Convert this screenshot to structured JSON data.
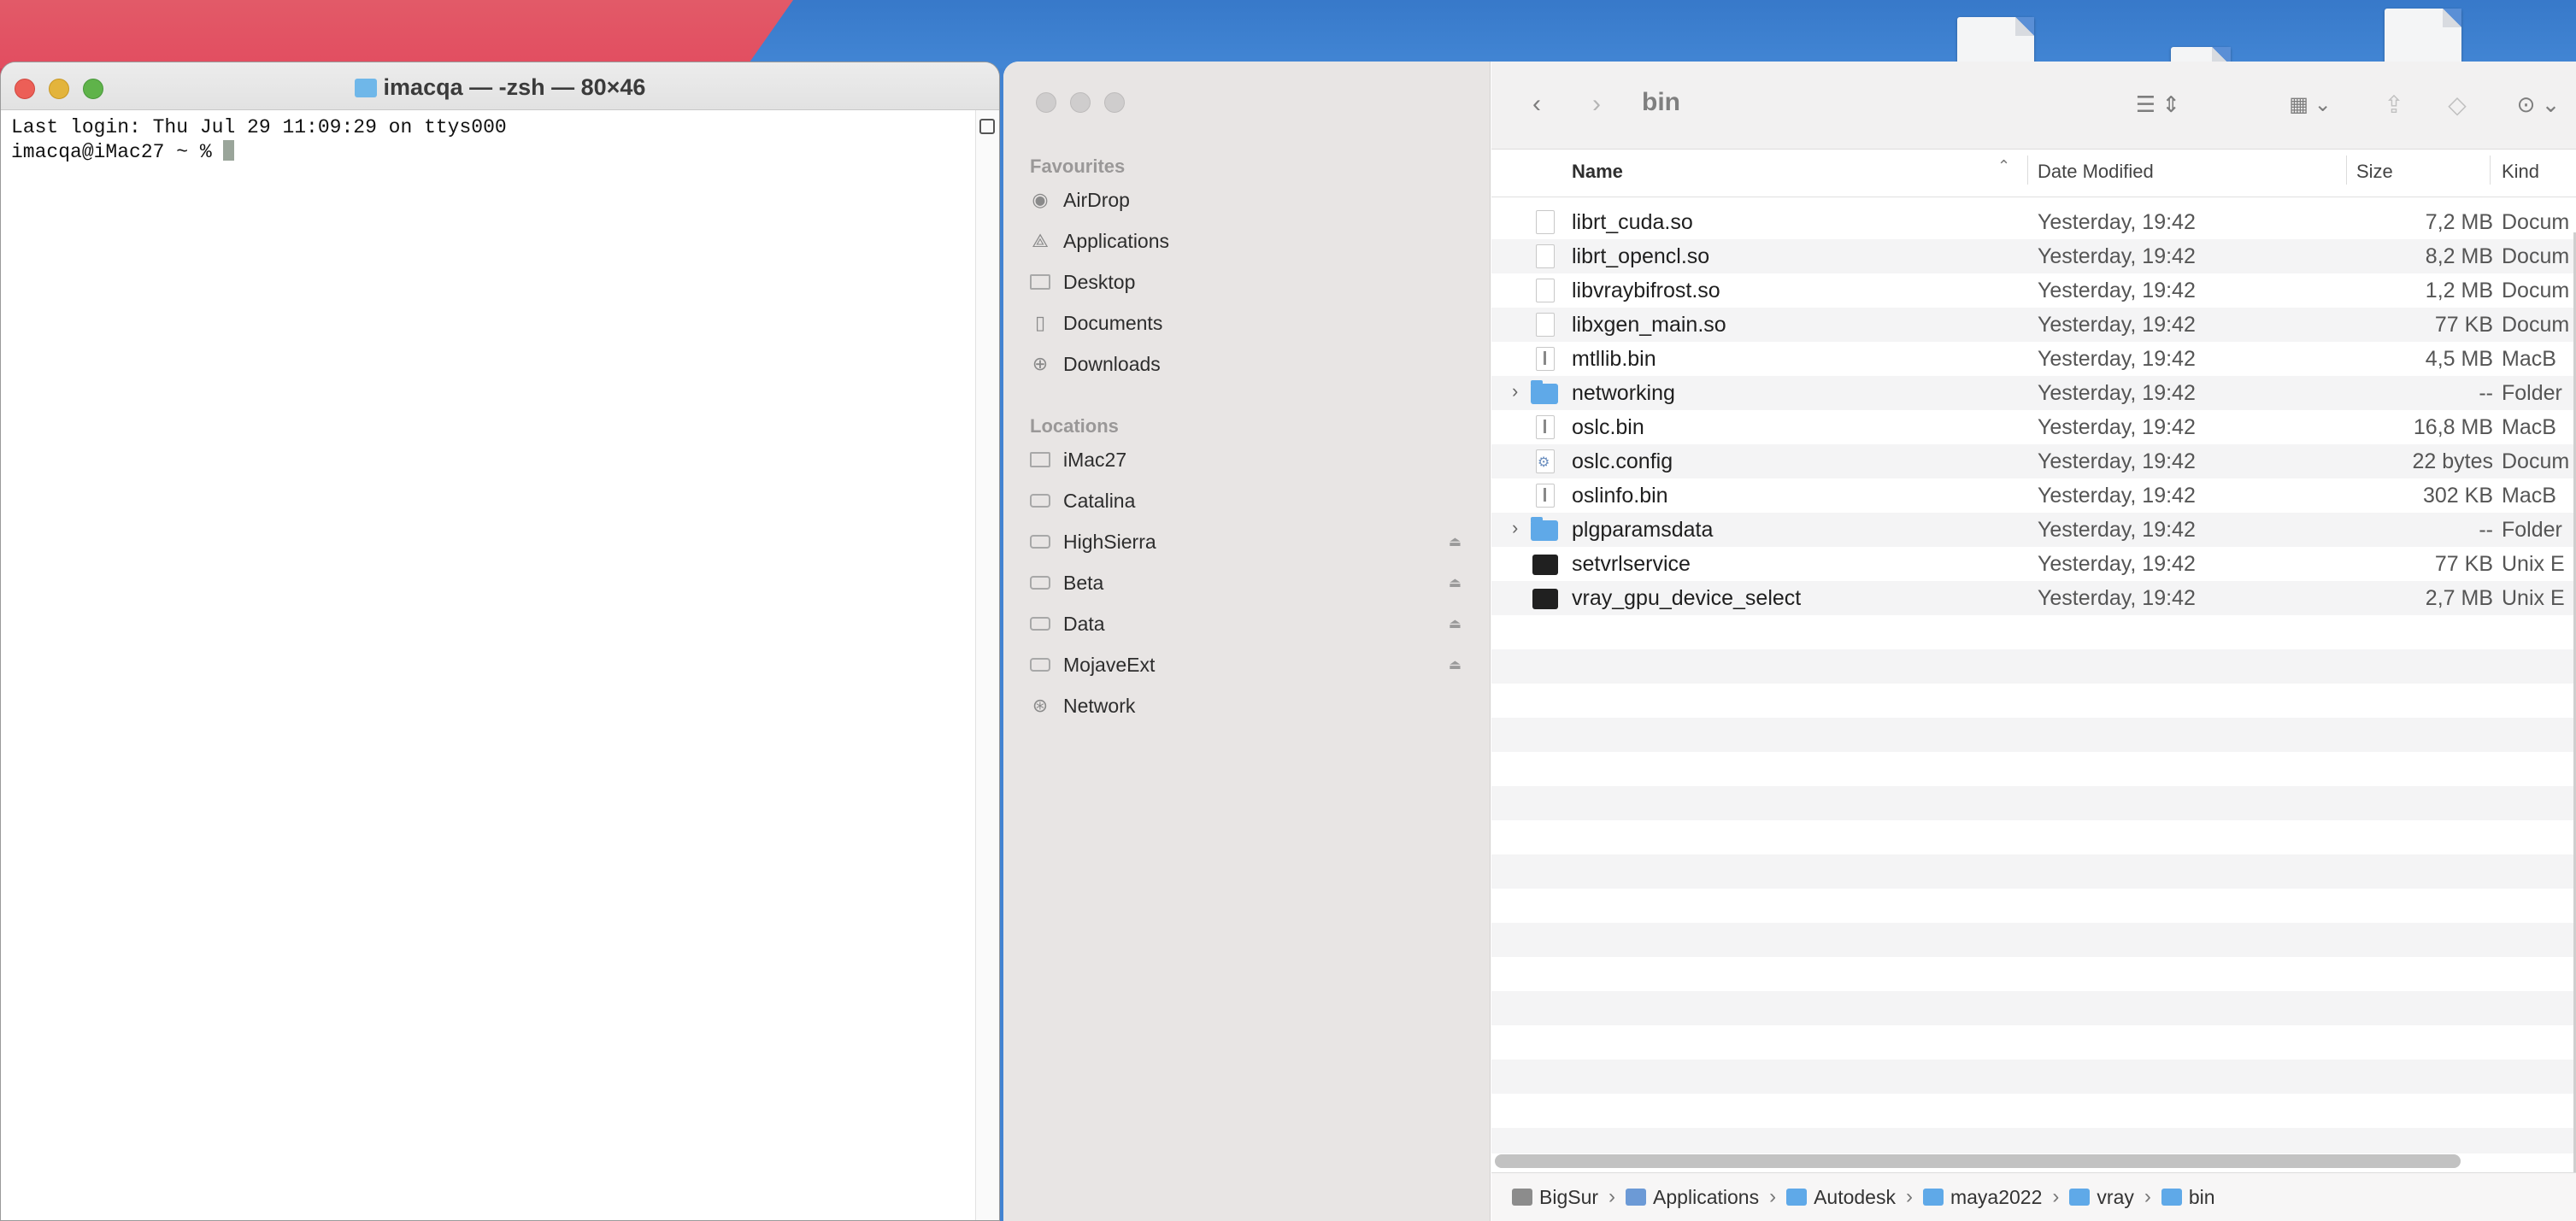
{
  "terminal": {
    "title": "imacqa — -zsh — 80×46",
    "lines": [
      "Last login: Thu Jul 29 11:09:29 on ttys000",
      "imacqa@iMac27 ~ % "
    ]
  },
  "finder": {
    "toolbar": {
      "title": "bin"
    },
    "sidebar": {
      "favourites_header": "Favourites",
      "favourites": [
        {
          "label": "AirDrop",
          "icon": "airdrop-icon"
        },
        {
          "label": "Applications",
          "icon": "applications-icon"
        },
        {
          "label": "Desktop",
          "icon": "desktop-icon"
        },
        {
          "label": "Documents",
          "icon": "document-icon"
        },
        {
          "label": "Downloads",
          "icon": "download-icon"
        }
      ],
      "locations_header": "Locations",
      "locations": [
        {
          "label": "iMac27",
          "icon": "computer-icon"
        },
        {
          "label": "Catalina",
          "icon": "disk-icon"
        },
        {
          "label": "HighSierra",
          "icon": "disk-icon"
        },
        {
          "label": "Beta",
          "icon": "disk-icon"
        },
        {
          "label": "Data",
          "icon": "disk-icon"
        },
        {
          "label": "MojaveExt",
          "icon": "disk-icon"
        },
        {
          "label": "Network",
          "icon": "network-icon"
        }
      ]
    },
    "columns": {
      "name": "Name",
      "date": "Date Modified",
      "size": "Size",
      "kind": "Kind"
    },
    "files": [
      {
        "name": "librt_cuda.so",
        "date": "Yesterday, 19:42",
        "size": "7,2 MB",
        "kind": "Docum",
        "icon": "doc"
      },
      {
        "name": "librt_opencl.so",
        "date": "Yesterday, 19:42",
        "size": "8,2 MB",
        "kind": "Docum",
        "icon": "doc"
      },
      {
        "name": "libvraybifrost.so",
        "date": "Yesterday, 19:42",
        "size": "1,2 MB",
        "kind": "Docum",
        "icon": "doc"
      },
      {
        "name": "libxgen_main.so",
        "date": "Yesterday, 19:42",
        "size": "77 KB",
        "kind": "Docum",
        "icon": "doc"
      },
      {
        "name": "mtllib.bin",
        "date": "Yesterday, 19:42",
        "size": "4,5 MB",
        "kind": "MacB",
        "icon": "exec"
      },
      {
        "name": "networking",
        "date": "Yesterday, 19:42",
        "size": "--",
        "kind": "Folder",
        "icon": "folder"
      },
      {
        "name": "oslc.bin",
        "date": "Yesterday, 19:42",
        "size": "16,8 MB",
        "kind": "MacB",
        "icon": "exec"
      },
      {
        "name": "oslc.config",
        "date": "Yesterday, 19:42",
        "size": "22 bytes",
        "kind": "Docum",
        "icon": "config"
      },
      {
        "name": "oslinfo.bin",
        "date": "Yesterday, 19:42",
        "size": "302 KB",
        "kind": "MacB",
        "icon": "exec"
      },
      {
        "name": "plgparamsdata",
        "date": "Yesterday, 19:42",
        "size": "--",
        "kind": "Folder",
        "icon": "folder"
      },
      {
        "name": "setvrlservice",
        "date": "Yesterday, 19:42",
        "size": "77 KB",
        "kind": "Unix E",
        "icon": "term"
      },
      {
        "name": "vray_gpu_device_select",
        "date": "Yesterday, 19:42",
        "size": "2,7 MB",
        "kind": "Unix E",
        "icon": "term"
      }
    ],
    "path": [
      "BigSur",
      "Applications",
      "Autodesk",
      "maya2022",
      "vray",
      "bin"
    ]
  }
}
